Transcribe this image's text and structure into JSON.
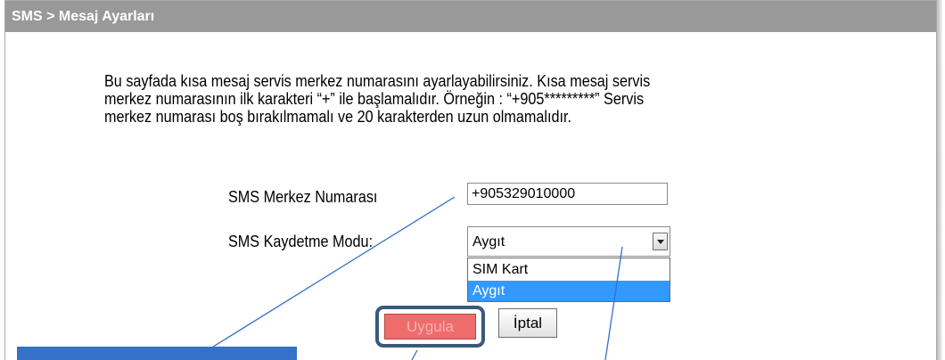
{
  "header": {
    "title": "SMS > Mesaj Ayarları"
  },
  "description": {
    "lines": [
      "Bu sayfada kısa mesaj servis merkez numarasını ayarlayabilirsiniz. Kısa mesaj servis",
      "merkez numarasının ilk karakteri “+” ile başlamalıdır. Örneğin : “+905*********” Servis",
      "merkez numarası boş bırakılmamalı ve 20 karakterden uzun olmamalıdır."
    ]
  },
  "form": {
    "center_number_label": "SMS Merkez Numarası",
    "center_number_value": "+905329010000",
    "save_mode_label": "SMS Kaydetme Modu:",
    "save_mode_value": "Aygıt",
    "save_mode_options": [
      "SIM Kart",
      "Aygıt"
    ],
    "apply_label": "Uygula",
    "cancel_label": "İptal"
  },
  "colors": {
    "header_bg": "#999999",
    "selected_option": "#3399ff",
    "apply_button": "#ef6c6c",
    "callout": "#3571c8"
  }
}
